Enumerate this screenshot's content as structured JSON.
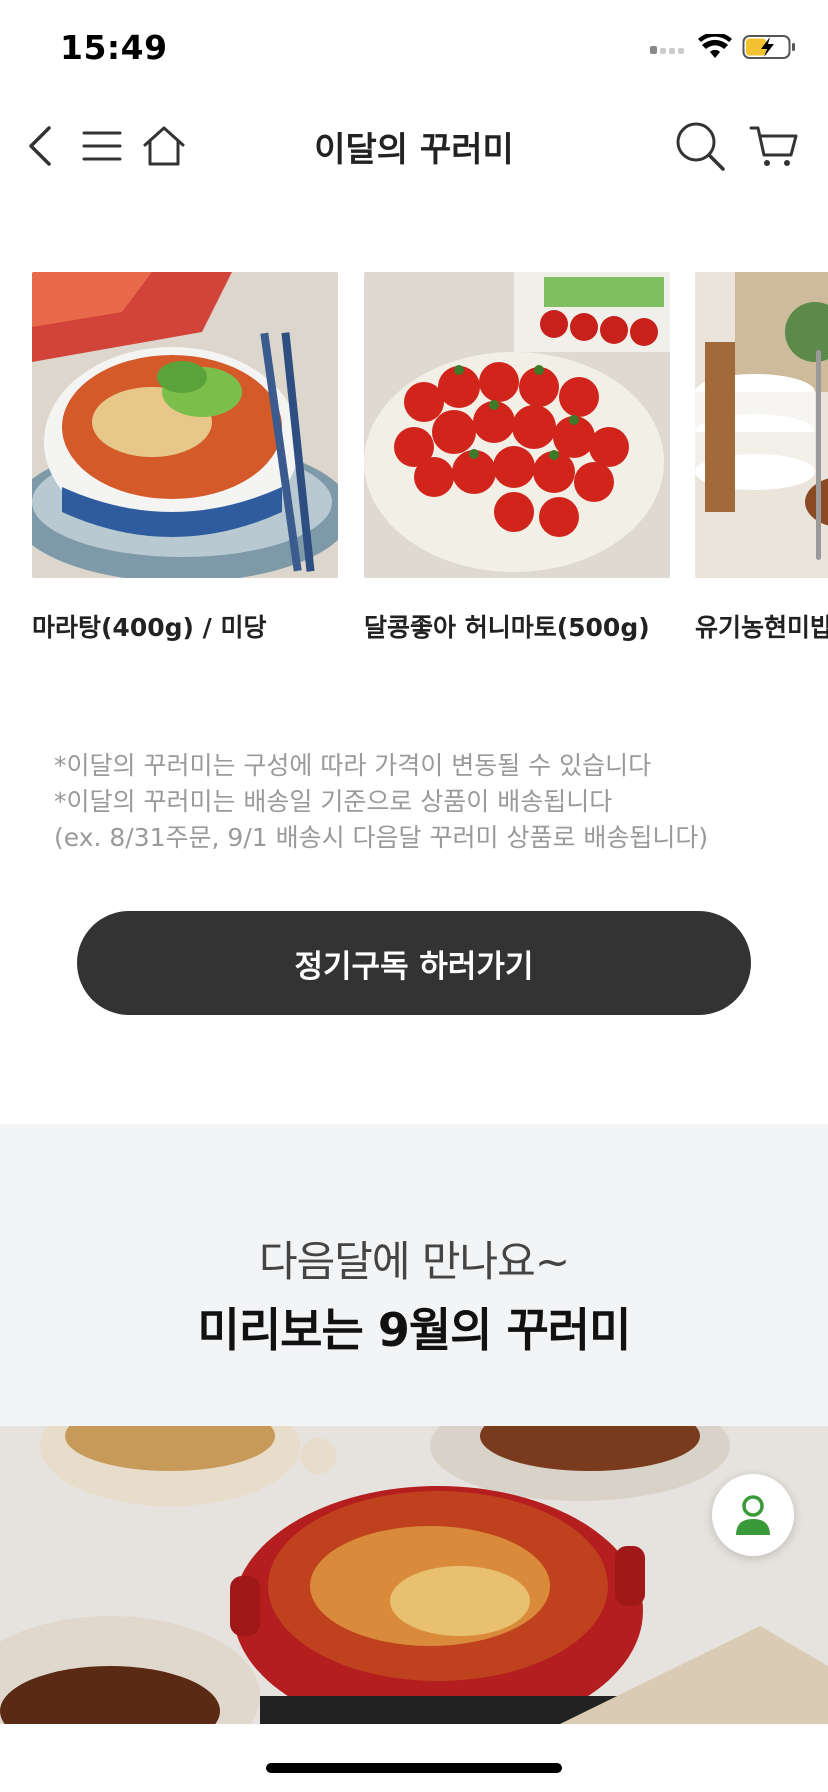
{
  "status": {
    "time": "15:49"
  },
  "header": {
    "title": "이달의 꾸러미"
  },
  "products": [
    {
      "name": "마라탕(400g) / 미당",
      "image": "malatang-bowl"
    },
    {
      "name": "달콩좋아 허니마토(500g)",
      "image": "cherry-tomatoes"
    },
    {
      "name": "유기농현미밥",
      "image": "rice-packs"
    }
  ],
  "notice": {
    "line1": "*이달의 꾸러미는 구성에 따라 가격이 변동될 수 있습니다",
    "line2": "*이달의 꾸러미는 배송일 기준으로 상품이 배송됩니다",
    "line3": "(ex. 8/31주문, 9/1 배송시 다음달 꾸러미 상품로 배송됩니다)"
  },
  "subscribe": {
    "label": "정기구독 하러가기"
  },
  "preview": {
    "subtitle": "다음달에 만나요~",
    "title": "미리보는 9월의 꾸러미"
  },
  "colors": {
    "button": "#333333",
    "preview_bg": "#f3f4f6",
    "profile_icon": "#3a9a3a"
  }
}
